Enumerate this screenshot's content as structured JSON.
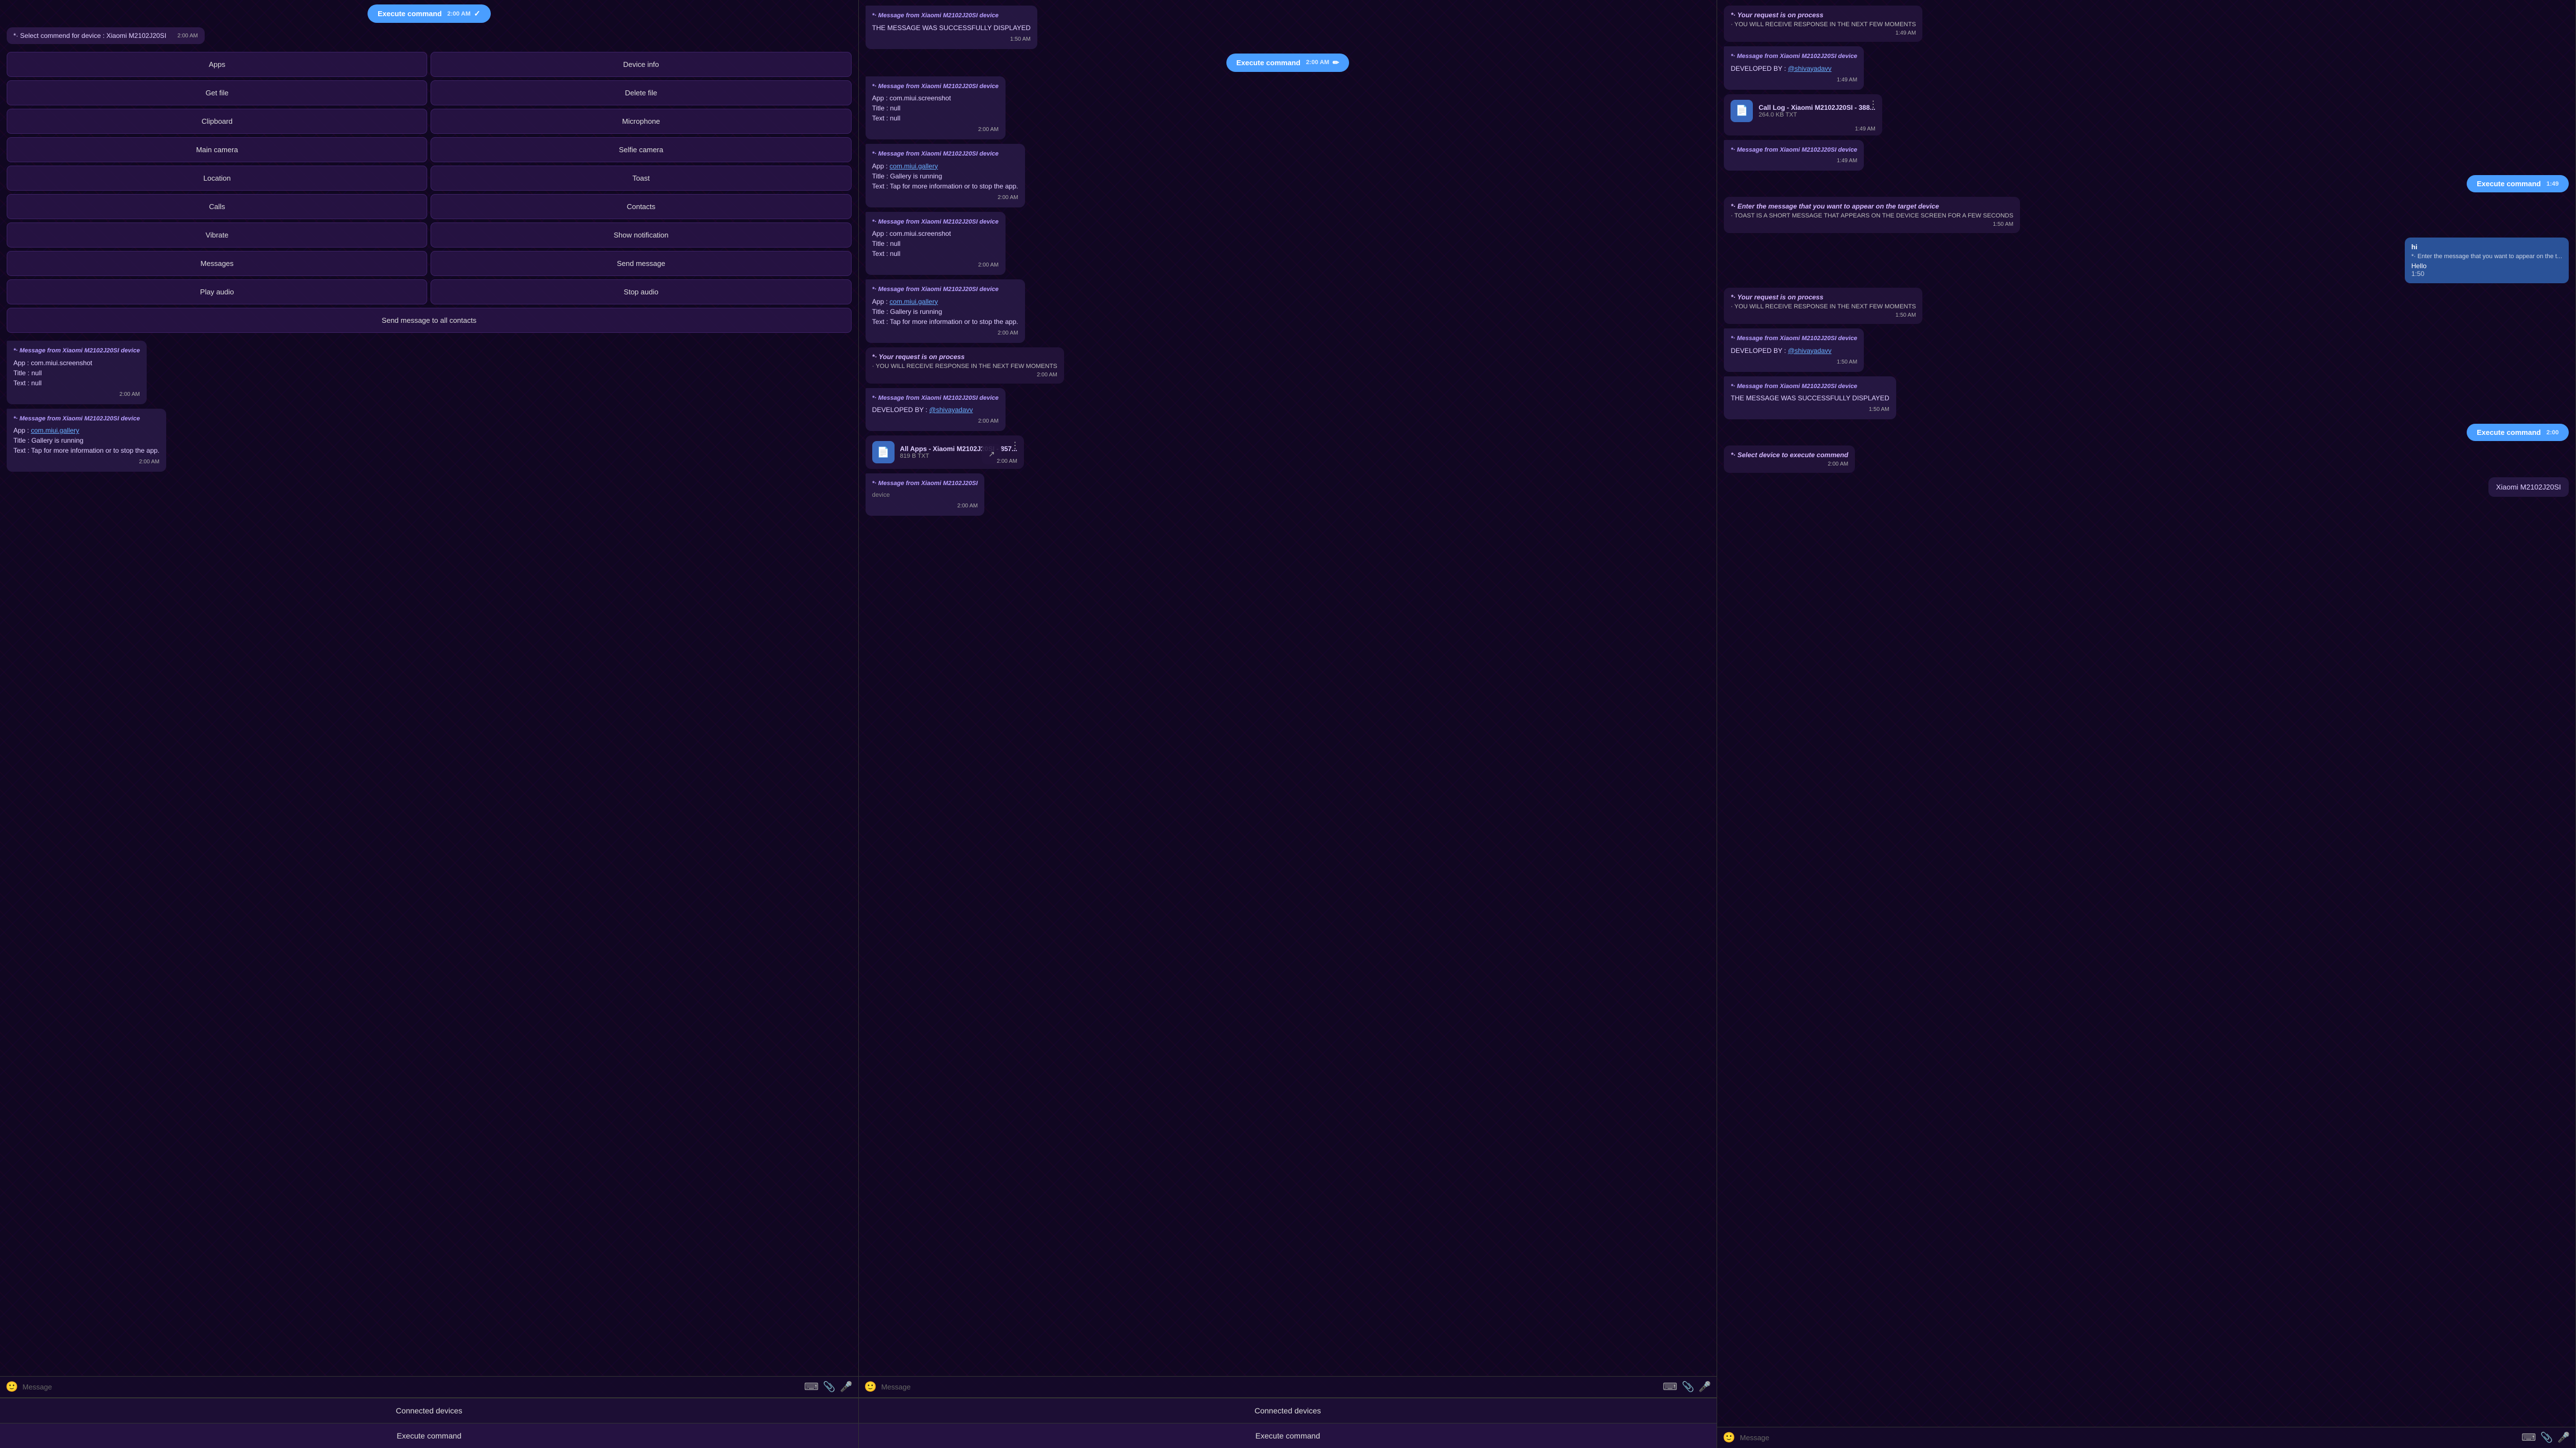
{
  "panels": [
    {
      "id": "left",
      "execute_bubble": {
        "label": "Execute command",
        "time": "2:00 AM"
      },
      "select_msg": {
        "prefix": "*·",
        "text": " Select commend for device",
        "device": " : Xiaomi M2102J20SI",
        "time": "2:00 AM"
      },
      "commands": [
        {
          "label": "Apps",
          "id": "apps"
        },
        {
          "label": "Device info",
          "id": "device-info"
        },
        {
          "label": "Get file",
          "id": "get-file"
        },
        {
          "label": "Delete file",
          "id": "delete-file"
        },
        {
          "label": "Clipboard",
          "id": "clipboard"
        },
        {
          "label": "Microphone",
          "id": "microphone"
        },
        {
          "label": "Main camera",
          "id": "main-camera"
        },
        {
          "label": "Selfie camera",
          "id": "selfie-camera"
        },
        {
          "label": "Location",
          "id": "location"
        },
        {
          "label": "Toast",
          "id": "toast"
        },
        {
          "label": "Calls",
          "id": "calls"
        },
        {
          "label": "Contacts",
          "id": "contacts"
        },
        {
          "label": "Vibrate",
          "id": "vibrate"
        },
        {
          "label": "Show notification",
          "id": "show-notification"
        },
        {
          "label": "Messages",
          "id": "messages"
        },
        {
          "label": "Send message",
          "id": "send-message"
        },
        {
          "label": "Play audio",
          "id": "play-audio"
        },
        {
          "label": "Stop audio",
          "id": "stop-audio"
        },
        {
          "label": "Send message to all contacts",
          "id": "send-all",
          "fullWidth": true
        }
      ],
      "messages": [
        {
          "type": "received",
          "header": "*· Message from Xiaomi M2102J20SI device",
          "body": "App : com.miui.screenshot\nTitle : null\nText : null",
          "time": "2:00 AM"
        },
        {
          "type": "received",
          "header": "*· Message from Xiaomi M2102J20SI device",
          "body": "App : com.miui.gallery\nTitle : Gallery is running\nText : Tap for more information or to stop the app.",
          "link": "com.miui.gallery",
          "time": "2:00 AM"
        }
      ],
      "input": {
        "placeholder": "Message"
      },
      "bottom_buttons": [
        {
          "label": "Connected devices",
          "id": "connected-devices-left"
        },
        {
          "label": "Execute command",
          "id": "execute-command-left"
        }
      ]
    },
    {
      "id": "middle",
      "execute_bubble": {
        "label": "Execute command",
        "time": "2:00 AM"
      },
      "messages": [
        {
          "type": "received_header",
          "header": "*· Message from Xiaomi M2102J20SI device",
          "body": "THE MESSAGE WAS SUCCESSFULLY DISPLAYED",
          "time": "1:50 AM"
        },
        {
          "type": "received",
          "header": "*· Message from Xiaomi M2102J20SI device",
          "body": "App : com.miui.screenshot\nTitle : null\nText : null",
          "time": "2:00 AM"
        },
        {
          "type": "received",
          "header": "*· Message from Xiaomi M2102J20SI device",
          "body_lines": [
            "App : com.miui.gallery",
            "Title : Gallery is running",
            "Text : Tap for more information or to stop the app."
          ],
          "has_link": true,
          "link_text": "com.miui.gallery",
          "time": "2:00 AM"
        },
        {
          "type": "received",
          "header": "*· Message from Xiaomi M2102J20SI device",
          "body": "App : com.miui.screenshot\nTitle : null\nText : null",
          "time": "2:00 AM"
        },
        {
          "type": "received",
          "header": "*· Message from Xiaomi M2102J20SI device",
          "body_lines": [
            "App : com.miui.gallery",
            "Title : Gallery is running",
            "Text : Tap for more information or to stop the app."
          ],
          "has_link": true,
          "link_text": "com.miui.gallery",
          "time": "2:00 AM"
        },
        {
          "type": "status",
          "title": "*· Your request is on process",
          "body": "· YOU WILL RECEIVE RESPONSE IN THE NEXT FEW MOMENTS",
          "time": "2:00 AM"
        },
        {
          "type": "received_dev",
          "header": "*· Message from Xiaomi M2102J20SI device",
          "body": "DEVELOPED BY : @shivayadavv",
          "time": "2:00 AM"
        },
        {
          "type": "file",
          "name": "All Apps  -  Xiaomi M2102J20SI  -  857...",
          "size": "819 B TXT",
          "time": "2:00 AM"
        },
        {
          "type": "received",
          "header": "*· Message from Xiaomi M2102J20SI device",
          "body": "",
          "time": "2:00 AM",
          "partial": true,
          "partial_text": "*· Message from Xiaomi M2102J20SI"
        }
      ],
      "input": {
        "placeholder": "Message"
      },
      "bottom_buttons": [
        {
          "label": "Connected devices",
          "id": "connected-devices-mid"
        },
        {
          "label": "Execute command",
          "id": "execute-command-mid"
        }
      ]
    },
    {
      "id": "right",
      "messages": [
        {
          "type": "status",
          "title": "*· Your request is on process",
          "body": "· YOU WILL RECEIVE RESPONSE IN THE NEXT FEW MOMENTS",
          "time": "1:49 AM"
        },
        {
          "type": "received_dev",
          "header": "*· Message from Xiaomi M2102J20SI device",
          "body": "DEVELOPED BY : @shivayadavv",
          "time": "1:49 AM"
        },
        {
          "type": "file",
          "name": "Call Log  -  Xiaomi M2102J20SI  -  388...",
          "size": "264.0 KB TXT",
          "time": "1:49 AM"
        },
        {
          "type": "received_short",
          "header": "*· Message from Xiaomi M2102J20SI device",
          "time": "1:49 AM"
        },
        {
          "type": "execute_right",
          "label": "Execute command",
          "time": "1:49"
        },
        {
          "type": "instruction",
          "title": "*· Enter the message that you want to appear on the target device",
          "body": "· TOAST IS A SHORT MESSAGE THAT APPEARS ON THE DEVICE SCREEN FOR A FEW SECONDS",
          "time": "1:50 AM"
        },
        {
          "type": "toast_input",
          "greeting": "hi",
          "prompt": "*· Enter the message that you want to appear on the t...",
          "value": "Hello",
          "time": "1:50"
        },
        {
          "type": "status",
          "title": "*· Your request is on process",
          "body": "· YOU WILL RECEIVE RESPONSE IN THE NEXT FEW MOMENTS",
          "time": "1:50 AM"
        },
        {
          "type": "received_dev",
          "header": "*· Message from Xiaomi M2102J20SI device",
          "body": "DEVELOPED BY : @shivayadavv",
          "time": "1:50 AM"
        },
        {
          "type": "received_header",
          "header": "*· Message from Xiaomi M2102J20SI device",
          "body": "THE MESSAGE WAS SUCCESSFULLY DISPLAYED",
          "time": "1:50 AM"
        },
        {
          "type": "execute_right",
          "label": "Execute command",
          "time": "2:00"
        },
        {
          "type": "status",
          "title": "*· Select device to execute commend",
          "body": "",
          "time": "2:00 AM"
        },
        {
          "type": "device_select",
          "label": "Xiaomi M2102J20SI",
          "time": ""
        }
      ],
      "input": {
        "placeholder": "Message"
      }
    }
  ]
}
